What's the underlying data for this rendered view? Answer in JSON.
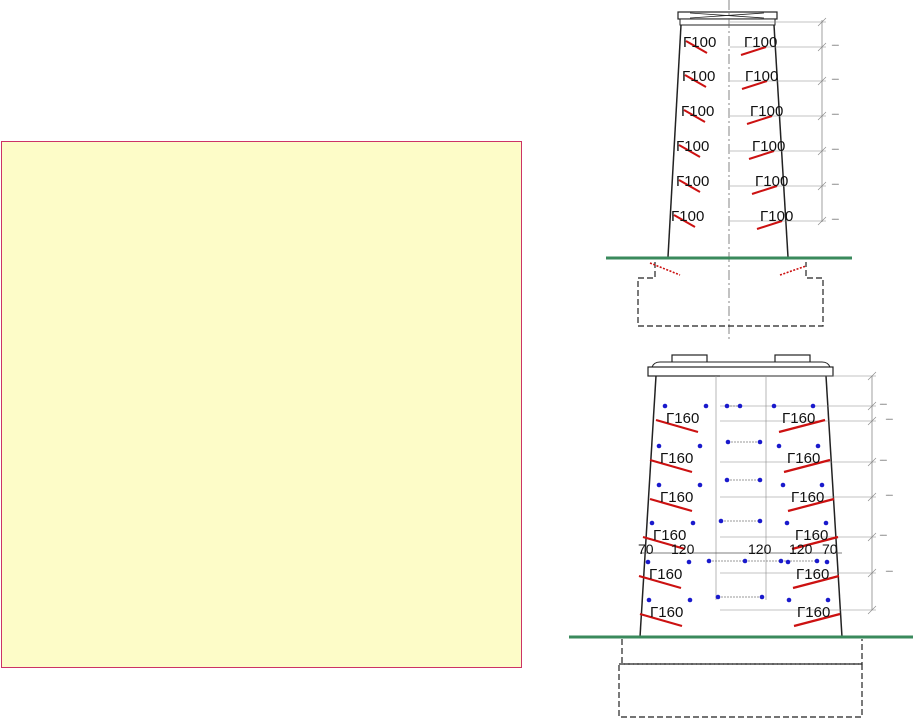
{
  "colors": {
    "panel_fill": "#fdfcc8",
    "panel_border": "#cc3366",
    "rebar": "#cc1111",
    "ground": "#3a8a5c",
    "dot": "#1a1acc",
    "line": "#222222",
    "dim_line": "#888888"
  },
  "top_pier": {
    "left_labels": [
      "Γ100",
      "Γ100",
      "Γ100",
      "Γ100",
      "Γ100",
      "Γ100"
    ],
    "right_labels": [
      "Γ100",
      "Γ100",
      "Γ100",
      "Γ100",
      "Γ100",
      "Γ100"
    ],
    "dim_notes": [
      "-----",
      "-----",
      "-----",
      "-----",
      "-----",
      "-----"
    ]
  },
  "bottom_pier": {
    "left_labels": [
      "Γ160",
      "Γ160",
      "Γ160",
      "Γ160",
      "Γ160",
      "Γ160"
    ],
    "right_labels": [
      "Γ160",
      "Γ160",
      "Γ160",
      "Γ160",
      "Γ160",
      "Γ160"
    ],
    "spacing_dims": [
      "70",
      "120",
      "120",
      "120",
      "70"
    ],
    "dim_notes": [
      "-----",
      "-----",
      "-----",
      "-----",
      "-----",
      "-----"
    ]
  }
}
